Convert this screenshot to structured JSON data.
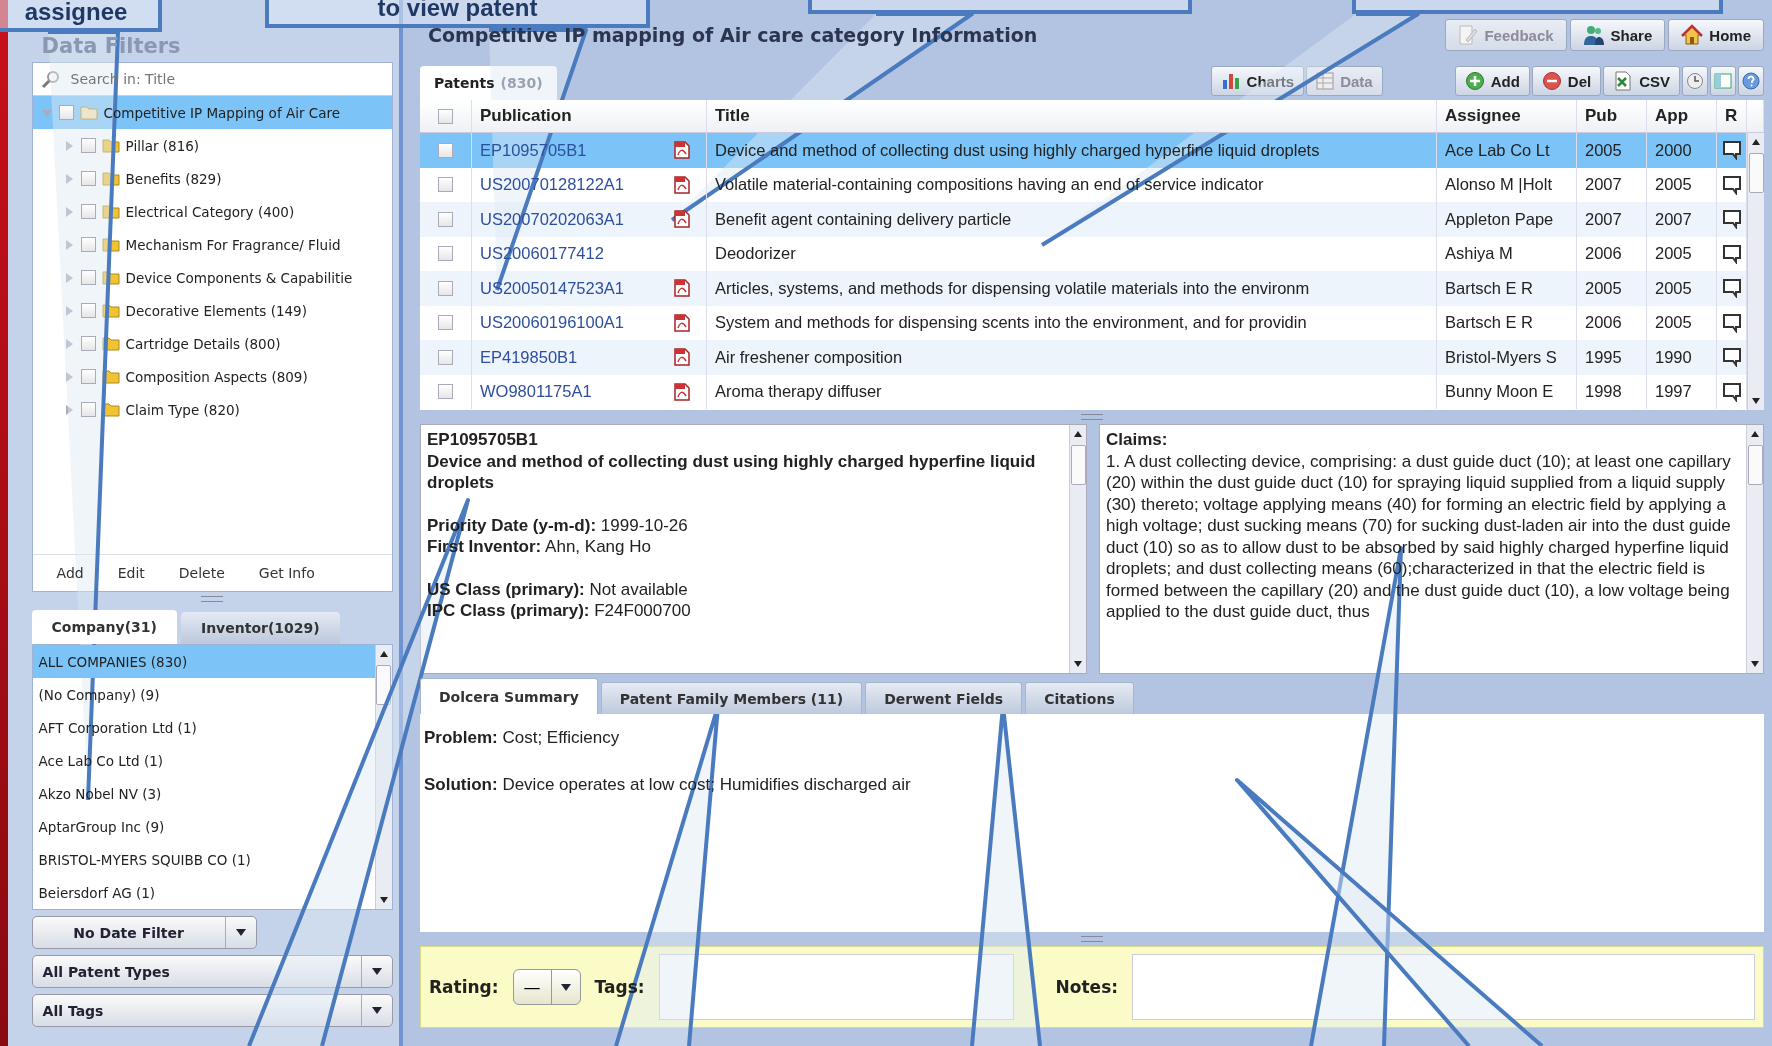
{
  "callouts": [
    {
      "kind": "box",
      "text": "assignee"
    },
    {
      "kind": "box",
      "text": "to view patent"
    },
    {
      "kind": "box"
    },
    {
      "kind": "box"
    }
  ],
  "filters": {
    "title": "Data Filters",
    "search": {
      "placeholder": "Search in: Title"
    },
    "tree": [
      {
        "label": "Competitive IP Mapping of Air Care",
        "expanded": true,
        "selected": true,
        "children": [
          {
            "label": "Pillar (816)",
            "expanded": false,
            "selected": false
          },
          {
            "label": "Benefits (829)",
            "expanded": false,
            "selected": false
          },
          {
            "label": "Electrical Category (400)",
            "expanded": false,
            "selected": false
          },
          {
            "label": "Mechanism For Fragrance/ Fluid",
            "expanded": false,
            "selected": false
          },
          {
            "label": "Device Components & Capabilitie",
            "expanded": false,
            "selected": false
          },
          {
            "label": "Decorative Elements (149)",
            "expanded": false,
            "selected": false
          },
          {
            "label": "Cartridge Details (800)",
            "expanded": false,
            "selected": false
          },
          {
            "label": "Composition Aspects (809)",
            "expanded": false,
            "selected": false
          },
          {
            "label": "Claim Type (820)",
            "expanded": false,
            "selected": false
          }
        ]
      }
    ],
    "tree_actions": [
      "Add",
      "Edit",
      "Delete",
      "Get Info"
    ],
    "tabs": [
      {
        "label": "Company(31)",
        "selected": true
      },
      {
        "label": "Inventor(1029)",
        "selected": false
      }
    ],
    "companies": [
      {
        "label": "ALL COMPANIES (830)",
        "selected": true
      },
      {
        "label": "(No Company) (9)",
        "selected": false
      },
      {
        "label": "AFT Corporation Ltd (1)",
        "selected": false
      },
      {
        "label": "Ace Lab Co Ltd (1)",
        "selected": false
      },
      {
        "label": "Akzo Nobel NV (3)",
        "selected": false
      },
      {
        "label": "AptarGroup Inc (9)",
        "selected": false
      },
      {
        "label": "BRISTOL-MYERS SQUIBB CO (1)",
        "selected": false
      },
      {
        "label": "Beiersdorf AG (1)",
        "selected": false
      }
    ],
    "dropdowns": [
      {
        "kind": "short",
        "label": "No Date Filter"
      },
      {
        "kind": "wide",
        "label": "All Patent Types"
      },
      {
        "kind": "wide",
        "label": "All Tags"
      }
    ]
  },
  "title": "Competitive IP mapping of Air care category Information",
  "header_buttons": [
    {
      "kind": "feedback",
      "label": "Feedback",
      "disabled": true
    },
    {
      "kind": "share",
      "label": "Share",
      "disabled": false
    },
    {
      "kind": "home",
      "label": "Home",
      "disabled": false
    }
  ],
  "results_tab": {
    "label": "Patents",
    "count": "(830)"
  },
  "toolbar": [
    {
      "kind": "charts",
      "label": "Charts",
      "disabled": false
    },
    {
      "kind": "data",
      "label": "Data",
      "disabled": true
    },
    {
      "kind": "add",
      "label": "Add",
      "disabled": false
    },
    {
      "kind": "del",
      "label": "Del",
      "disabled": false
    },
    {
      "kind": "csv",
      "label": "CSV",
      "disabled": false
    }
  ],
  "table": {
    "all_checked": false,
    "columns": [
      "Publication",
      "Title",
      "Assignee",
      "Pub",
      "App",
      "R"
    ],
    "rows": [
      {
        "publication": "EP1095705B1",
        "pdf": true,
        "title": "Device and method of collecting dust using highly charged hyperfine liquid droplets",
        "assignee": "Ace Lab Co Lt",
        "pub": "2005",
        "app": "2000",
        "selected": true,
        "checked": false
      },
      {
        "publication": "US20070128122A1",
        "pdf": true,
        "title": "Volatile material-containing compositions having an end of service indicator",
        "assignee": "Alonso M |Holt",
        "pub": "2007",
        "app": "2005",
        "selected": false,
        "checked": false
      },
      {
        "publication": "US20070202063A1",
        "pdf": true,
        "title": "Benefit agent containing delivery particle",
        "assignee": "Appleton Pape",
        "pub": "2007",
        "app": "2007",
        "selected": false,
        "checked": false
      },
      {
        "publication": "US20060177412",
        "pdf": false,
        "title": "Deodorizer",
        "assignee": "Ashiya M",
        "pub": "2006",
        "app": "2005",
        "selected": false,
        "checked": false
      },
      {
        "publication": "US20050147523A1",
        "pdf": true,
        "title": "Articles, systems, and methods for dispensing volatile materials into the environm",
        "assignee": "Bartsch E R",
        "pub": "2005",
        "app": "2005",
        "selected": false,
        "checked": false
      },
      {
        "publication": "US20060196100A1",
        "pdf": true,
        "title": "System and methods for dispensing scents into the environment, and for providin",
        "assignee": "Bartsch E R",
        "pub": "2006",
        "app": "2005",
        "selected": false,
        "checked": false
      },
      {
        "publication": "EP419850B1",
        "pdf": true,
        "title": "Air freshener composition",
        "assignee": "Bristol-Myers S",
        "pub": "1995",
        "app": "1990",
        "selected": false,
        "checked": false
      },
      {
        "publication": "WO9801175A1",
        "pdf": true,
        "title": "Aroma therapy diffuser",
        "assignee": "Bunny Moon E",
        "pub": "1998",
        "app": "1997",
        "selected": false,
        "checked": false
      }
    ]
  },
  "detail": {
    "publication": "EP1095705B1",
    "title": "Device and method of collecting dust using highly charged hyperfine liquid droplets",
    "field_groups": [
      [
        {
          "label": "Priority Date (y-m-d):",
          "value": "1999-10-26"
        },
        {
          "label": "First Inventor:",
          "value": "Ahn, Kang Ho"
        }
      ],
      [
        {
          "label": "US Class  (primary):",
          "value": "Not available"
        },
        {
          "label": "IPC Class (primary):",
          "value": "F24F000700"
        }
      ]
    ]
  },
  "claims": {
    "heading": "Claims:",
    "text": "1. A dust collecting device, comprising:   a dust guide duct (10); at least one capillary (20) within the dust guide duct (10) for spraying liquid supplied from a liquid supply (30) thereto; voltage applying means (40) for forming an electric field by applying a high voltage; dust sucking means (70) for sucking dust-laden air into the dust guide duct (10) so as to allow dust to be absorbed by said highly charged hyperfine liquid droplets; and dust collecting means (60);characterized in that the electric field is formed between the capillary (20) and the dust guide duct (10), a low voltage being applied to the dust guide duct, thus"
  },
  "detail_tabs": [
    {
      "label": "Dolcera Summary",
      "selected": true
    },
    {
      "label": "Patent Family Members (11)",
      "selected": false
    },
    {
      "label": "Derwent Fields",
      "selected": false
    },
    {
      "label": "Citations",
      "selected": false
    }
  ],
  "summary": [
    {
      "label": "Problem:",
      "value": "Cost; Efficiency"
    },
    {
      "label": "Solution:",
      "value": "Device operates at low cost; Humidifies discharged air"
    }
  ],
  "annotation_bar": {
    "rating_label": "Rating:",
    "rating_value": "—",
    "tags_label": "Tags:",
    "notes_label": "Notes:"
  }
}
